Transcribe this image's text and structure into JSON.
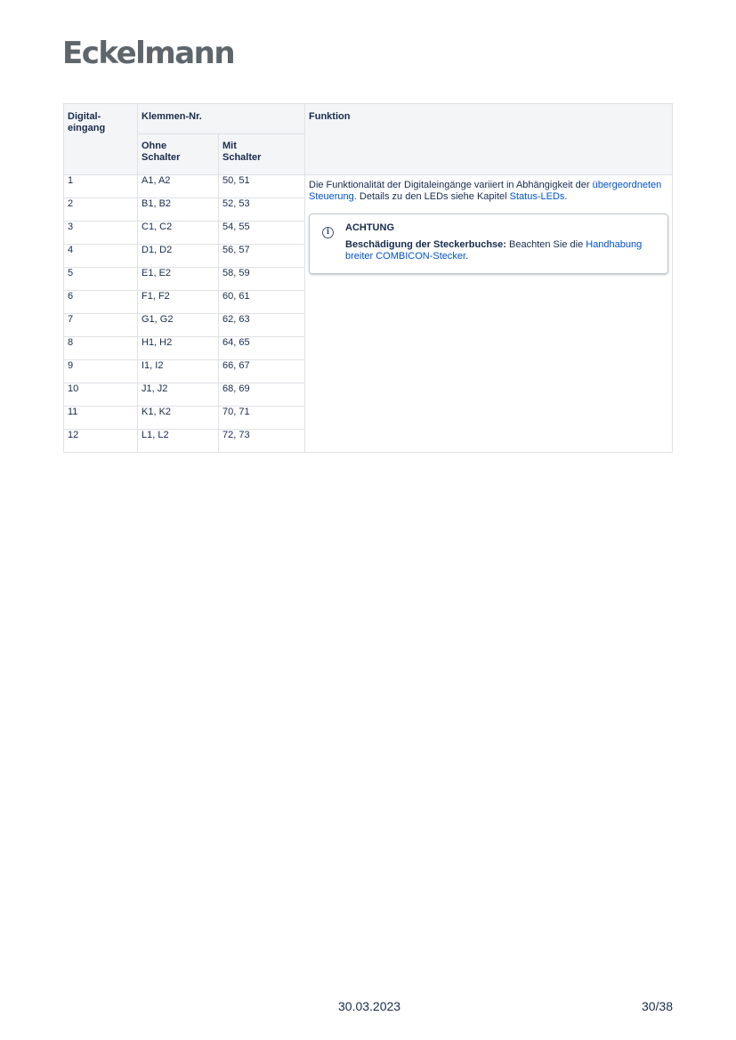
{
  "logo": "Eckelmann",
  "table": {
    "headers": {
      "digital": "Digital-\neingang",
      "klemmen": "Klemmen-Nr.",
      "funktion": "Funktion",
      "ohne": "Ohne\nSchalter",
      "mit": "Mit\nSchalter"
    },
    "rows": [
      [
        "1",
        "A1, A2",
        "50, 51"
      ],
      [
        "2",
        "B1, B2",
        "52, 53"
      ],
      [
        "3",
        "C1, C2",
        "54, 55"
      ],
      [
        "4",
        "D1, D2",
        "56, 57"
      ],
      [
        "5",
        "E1, E2",
        "58, 59"
      ],
      [
        "6",
        "F1, F2",
        "60, 61"
      ],
      [
        "7",
        "G1, G2",
        "62, 63"
      ],
      [
        "8",
        "H1, H2",
        "64, 65"
      ],
      [
        "9",
        "I1, I2",
        "66, 67"
      ],
      [
        "10",
        "J1, J2",
        "68, 69"
      ],
      [
        "11",
        "K1, K2",
        "70, 71"
      ],
      [
        "12",
        "L1, L2",
        "72, 73"
      ]
    ],
    "funktion": {
      "text1": "Die Funktionalität der Digitaleingänge variiert in Abhängigkeit der ",
      "link1": "übergeordneten Steuerung",
      "text2": ". Details zu den LEDs siehe Kapitel ",
      "link2": "Status-LEDs",
      "text3": "."
    },
    "note": {
      "icon": "info-icon",
      "title": "ACHTUNG",
      "bold": "Beschädigung der Steckerbuchse:",
      "text": " Beachten Sie die ",
      "link": "Handhabung breiter COMBICON-Stecker",
      "end": "."
    }
  },
  "footer": {
    "date": "30.03.2023",
    "page": "30/38"
  },
  "colors": {
    "link": "#0052cc",
    "header_bg": "#f4f5f7",
    "border": "#dfe1e6",
    "logo": "#5e656b"
  }
}
